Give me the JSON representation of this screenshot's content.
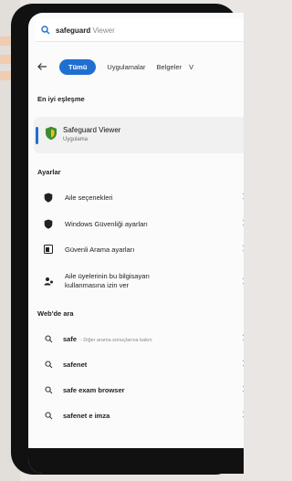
{
  "search": {
    "query": "safeguard",
    "ghost_completion": " Viewer"
  },
  "tabs": [
    {
      "label": "Tümü",
      "active": true
    },
    {
      "label": "Uygulamalar",
      "active": false
    },
    {
      "label": "Belgeler",
      "active": false
    },
    {
      "label": "V",
      "active": false
    }
  ],
  "best_match": {
    "section_title": "En iyi eşleşme",
    "title": "Safeguard Viewer",
    "subtitle": "Uygulama"
  },
  "settings": {
    "section_title": "Ayarlar",
    "items": [
      {
        "label": "Aile seçenekleri",
        "icon": "shield-icon"
      },
      {
        "label": "Windows Güvenliği ayarları",
        "icon": "shield-icon"
      },
      {
        "label": "Güvenli Arama ayarları",
        "icon": "safe-search-icon"
      },
      {
        "label_line1": "Aile üyelerinin bu bilgisayarı",
        "label_line2": "kullanmasına izin ver",
        "icon": "family-icon"
      }
    ]
  },
  "web": {
    "section_title": "Web'de ara",
    "items": [
      {
        "label": "safe",
        "hint": "- Diğer arama sonuçlarına bakın"
      },
      {
        "label": "safenet",
        "hint": ""
      },
      {
        "label": "safe exam browser",
        "hint": ""
      },
      {
        "label": "safenet e imza",
        "hint": ""
      }
    ]
  },
  "colors": {
    "accent": "#1f6fd1",
    "shield_green": "#3d8b2f",
    "shield_yellow": "#e9c21b"
  }
}
